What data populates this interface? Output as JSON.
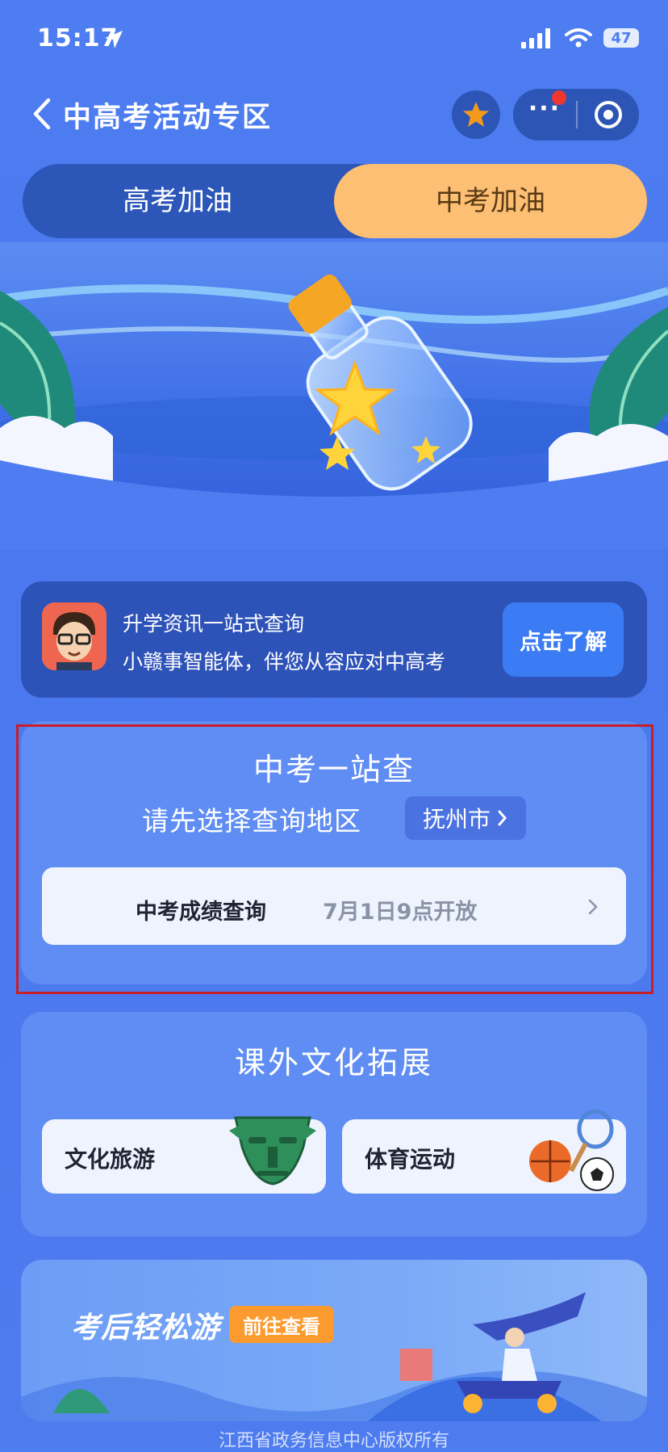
{
  "status_bar": {
    "time": "15:17",
    "battery": "47"
  },
  "nav": {
    "title": "中高考活动专区"
  },
  "tabs": [
    {
      "label": "高考加油"
    },
    {
      "label": "中考加油"
    }
  ],
  "promo": {
    "title": "升学资讯一站式查询",
    "subtitle": "小赣事智能体，伴您从容应对中高考",
    "button": "点击了解"
  },
  "zhongkao": {
    "title": "中考一站查",
    "region_label": "请先选择查询地区",
    "region_value": "抚州市",
    "query": {
      "label": "中考成绩查询",
      "note": "7月1日9点开放"
    }
  },
  "culture": {
    "title": "课外文化拓展",
    "tiles": [
      {
        "label": "文化旅游"
      },
      {
        "label": "体育运动"
      }
    ]
  },
  "banner": {
    "title": "考后轻松游",
    "button": "前往查看"
  },
  "footer": {
    "text": "江西省政务信息中心版权所有"
  },
  "colors": {
    "background": "#4d7df0",
    "accent_orange": "#fcbf73",
    "highlight_border": "#c71e2a"
  }
}
